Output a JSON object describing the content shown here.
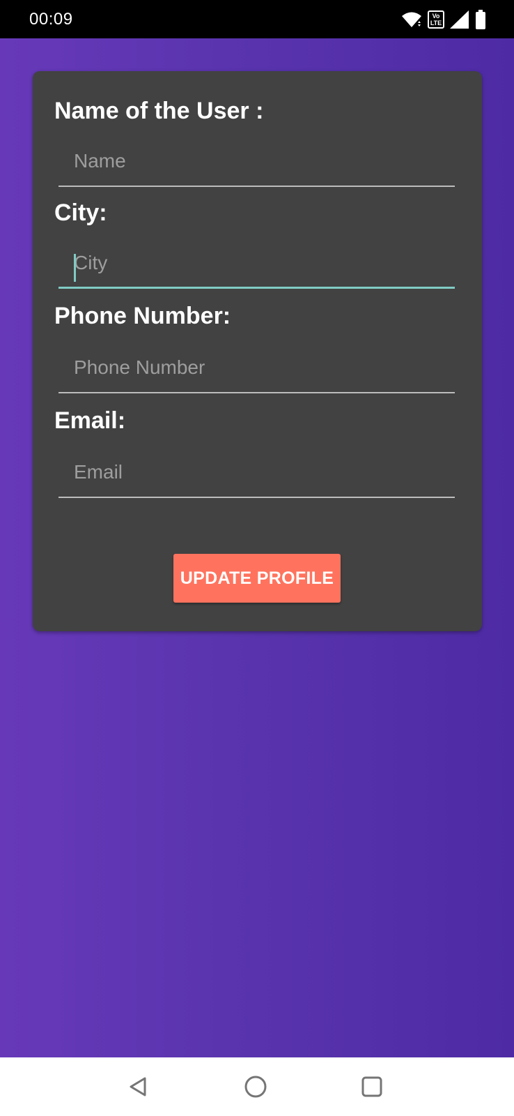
{
  "status_bar": {
    "time": "00:09",
    "icons": [
      "wifi-icon",
      "volte-icon",
      "signal-icon",
      "battery-icon"
    ],
    "volte_top": "Vo",
    "volte_bottom": "LTE"
  },
  "form": {
    "name_label": "Name of the User :",
    "name_placeholder": "Name",
    "city_label": "City:",
    "city_placeholder": "City",
    "phone_label": "Phone Number:",
    "phone_placeholder": "Phone Number",
    "email_label": "Email:",
    "email_placeholder": "Email",
    "update_button": "UPDATE PROFILE"
  },
  "nav_bar": {
    "icons": [
      "back-icon",
      "home-icon",
      "recents-icon"
    ]
  },
  "colors": {
    "background_gradient_start": "#6739b9",
    "background_gradient_end": "#4e2ba5",
    "card": "#424242",
    "button": "#ff735e",
    "focus_accent": "#80cbc4"
  }
}
